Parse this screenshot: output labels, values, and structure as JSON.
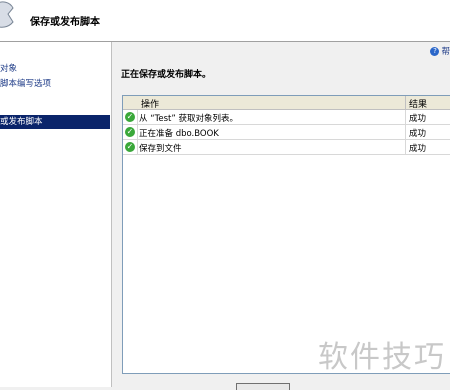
{
  "header": {
    "title": "保存或发布脚本"
  },
  "sidebar": {
    "items": [
      {
        "label": "对象"
      },
      {
        "label": "脚本编写选项"
      },
      {
        "label": "或发布脚本"
      }
    ]
  },
  "main": {
    "help_label": "帮",
    "status": "正在保存或发布脚本。",
    "columns": {
      "operation": "操作",
      "result": "结果"
    },
    "rows": [
      {
        "operation": "从 “Test” 获取对象列表。",
        "result": "成功"
      },
      {
        "operation": "正在准备 dbo.BOOK",
        "result": "成功"
      },
      {
        "operation": "保存到文件",
        "result": "成功"
      }
    ]
  },
  "watermark": "软件技巧",
  "icons": {
    "check": "check-circle-icon",
    "help": "help-icon",
    "wizard": "wizard-icon"
  }
}
